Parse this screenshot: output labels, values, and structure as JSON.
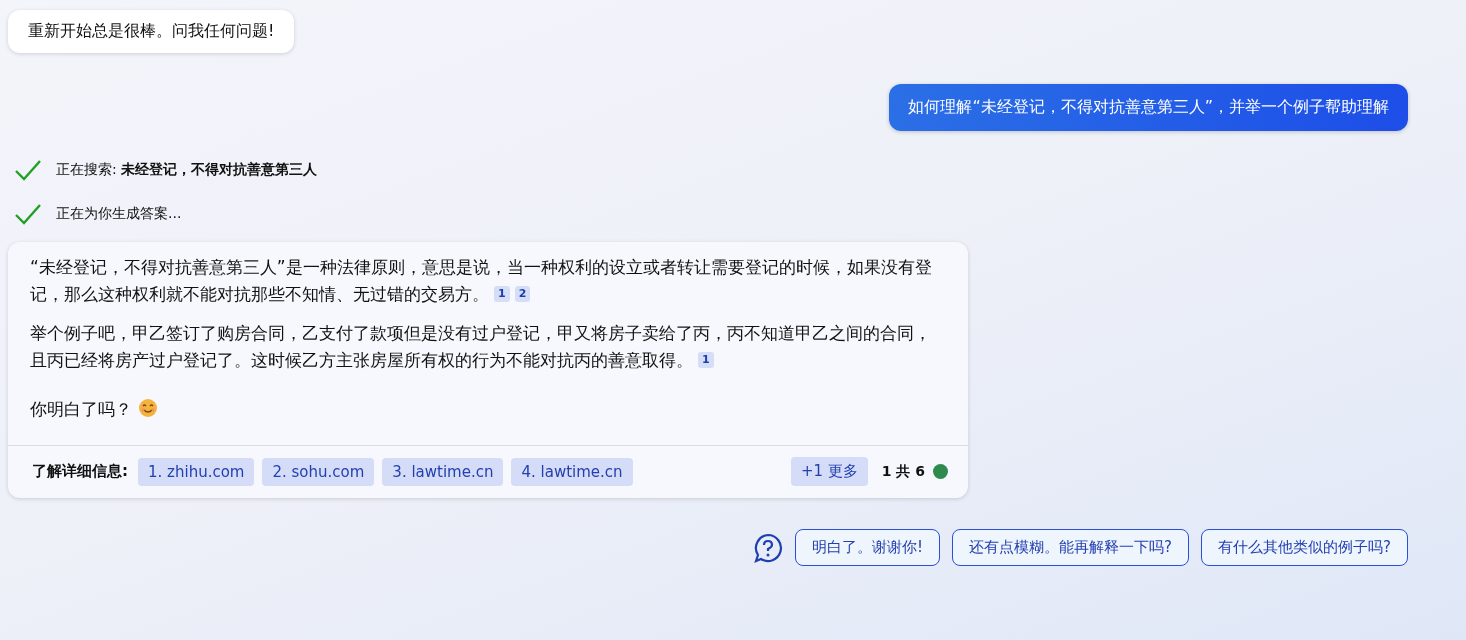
{
  "greeting": "重新开始总是很棒。问我任何问题!",
  "user_message": "如何理解“未经登记，不得对抗善意第三人”，并举一个例子帮助理解",
  "progress": [
    {
      "label": "正在搜索: ",
      "query": "未经登记，不得对抗善意第三人",
      "done": true
    },
    {
      "label": "正在为你生成答案...",
      "done": true
    }
  ],
  "answer": {
    "paragraphs": [
      {
        "text": "“未经登记，不得对抗善意第三人”是一种法律原则，意思是说，当一种权利的设立或者转让需要登记的时候，如果没有登记，那么这种权利就不能对抗那些不知情、无过错的交易方。",
        "citations": [
          "1",
          "2"
        ]
      },
      {
        "text": "举个例子吧，甲乙签订了购房合同，乙支付了款项但是没有过户登记，甲又将房子卖给了丙，丙不知道甲乙之间的合同，且丙已经将房产过户登记了。这时候乙方主张房屋所有权的行为不能对抗丙的善意取得。",
        "citations": [
          "1"
        ]
      },
      {
        "text": "你明白了吗？",
        "emoji": true
      }
    ],
    "footer": {
      "label": "了解详细信息:",
      "sources": [
        "1. zhihu.com",
        "2. sohu.com",
        "3. lawtime.cn",
        "4. lawtime.cn"
      ],
      "more": "+1 更多",
      "counter": "1 共 6"
    }
  },
  "suggestions": [
    "明白了。谢谢你!",
    "还有点模糊。能再解释一下吗?",
    "有什么其他类似的例子吗?"
  ]
}
